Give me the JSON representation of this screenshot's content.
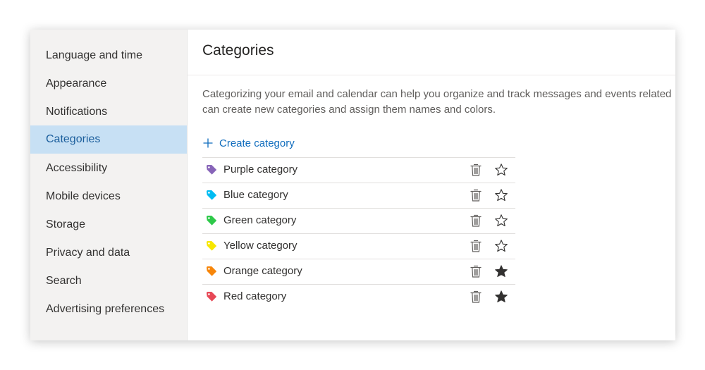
{
  "sidebar": {
    "items": [
      {
        "label": "Language and time",
        "selected": false
      },
      {
        "label": "Appearance",
        "selected": false
      },
      {
        "label": "Notifications",
        "selected": false
      },
      {
        "label": "Categories",
        "selected": true
      },
      {
        "label": "Accessibility",
        "selected": false
      },
      {
        "label": "Mobile devices",
        "selected": false
      },
      {
        "label": "Storage",
        "selected": false
      },
      {
        "label": "Privacy and data",
        "selected": false
      },
      {
        "label": "Search",
        "selected": false
      },
      {
        "label": "Advertising preferences",
        "selected": false
      }
    ]
  },
  "main": {
    "title": "Categories",
    "description_line1": "Categorizing your email and calendar can help you organize and track messages and events related",
    "description_line2": "can create new categories and assign them names and colors.",
    "create_label": "Create category",
    "create_icon": "plus-icon",
    "categories": [
      {
        "name": "Purple category",
        "color": "#8764b8",
        "favorite": false
      },
      {
        "name": "Blue category",
        "color": "#00bcf2",
        "favorite": false
      },
      {
        "name": "Green category",
        "color": "#2ec94a",
        "favorite": false
      },
      {
        "name": "Yellow category",
        "color": "#f7e700",
        "favorite": false
      },
      {
        "name": "Orange category",
        "color": "#f7860a",
        "favorite": true
      },
      {
        "name": "Red category",
        "color": "#e74856",
        "favorite": true
      }
    ]
  },
  "colors": {
    "accent": "#0f6cbd",
    "selected_background": "#c7e0f4",
    "sidebar_background": "#f3f2f1"
  }
}
